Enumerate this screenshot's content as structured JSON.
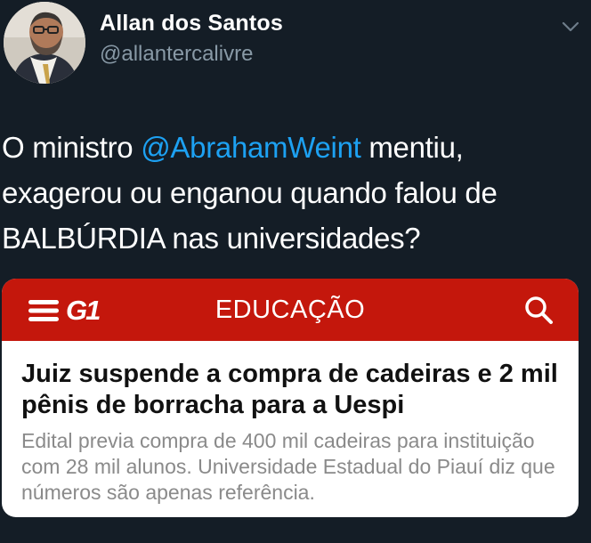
{
  "user": {
    "name": "Allan dos Santos",
    "handle": "@allantercalivre"
  },
  "tweet": {
    "text_before": "O ministro ",
    "mention": "@AbrahamWeint",
    "text_after": " mentiu, exagerou ou enganou quando falou de BALBÚRDIA nas universidades?"
  },
  "card": {
    "logo": "G1",
    "section": "EDUCAÇÃO",
    "headline": "Juiz suspende a compra de cadeiras e 2 mil pênis de borracha para a Uespi",
    "summary": "Edital previa compra de 400 mil cadeiras para instituição com 28 mil alunos. Universidade Estadual do Piauí diz que números são apenas referência."
  },
  "colors": {
    "background": "#141d26",
    "mention": "#1da1f2",
    "g1_red": "#c4170c"
  },
  "icons": [
    "avatar",
    "chevron-down-icon",
    "menu-icon",
    "search-icon"
  ]
}
